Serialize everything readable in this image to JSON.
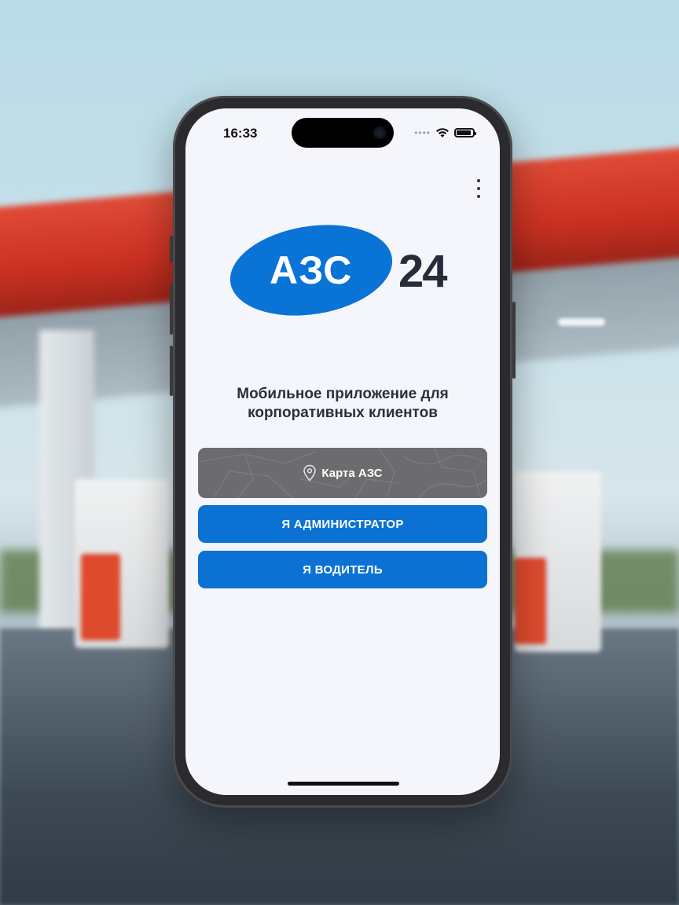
{
  "status_bar": {
    "time": "16:33"
  },
  "logo": {
    "brand": "АЗС",
    "number": "24"
  },
  "subtitle": {
    "line1": "Мобильное приложение для",
    "line2": "корпоративных клиентов"
  },
  "buttons": {
    "map": "Карта АЗС",
    "admin": "Я АДМИНИСТРАТОР",
    "driver": "Я ВОДИТЕЛЬ"
  },
  "icons": {
    "menu": "more-vertical-icon",
    "map_pin": "location-pin-icon",
    "wifi": "wifi-icon",
    "battery": "battery-icon",
    "signal": "signal-icon"
  },
  "colors": {
    "primary": "#0b72d4",
    "logo_blue": "#0a73d6",
    "logo_dark": "#262d3a",
    "map_button": "#6c6c6e",
    "screen_bg": "#f4f6fb"
  }
}
